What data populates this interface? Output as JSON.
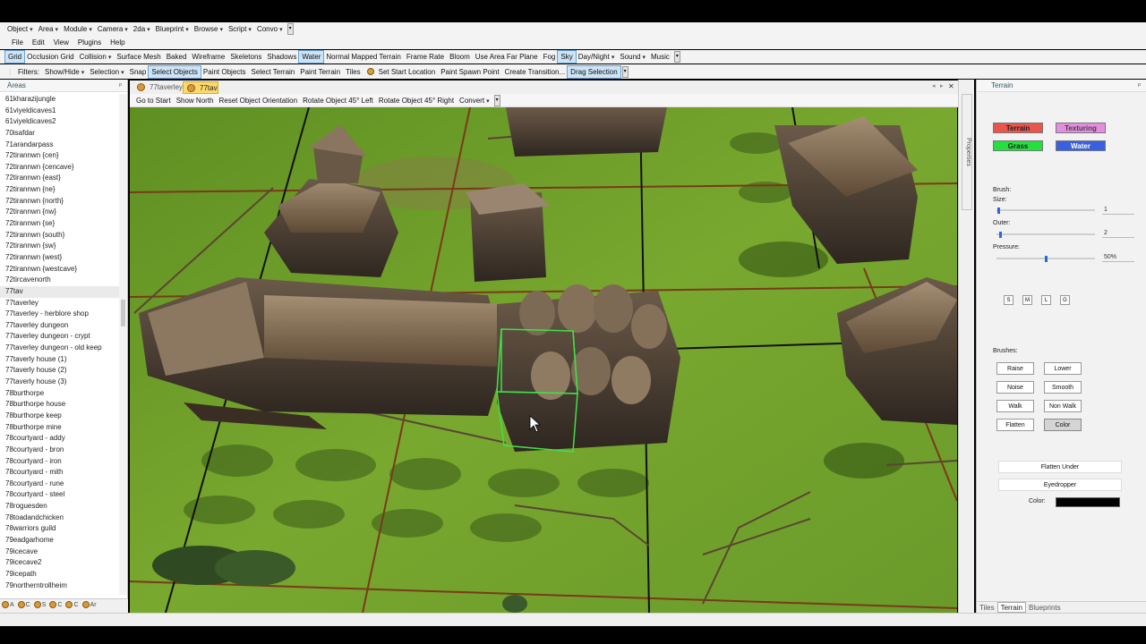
{
  "menu_top": [
    "Object",
    "Area",
    "Module",
    "Camera",
    "2da",
    "Blueprint",
    "Browse",
    "Script",
    "Convo"
  ],
  "menu_main": [
    "File",
    "Edit",
    "View",
    "Plugins",
    "Help"
  ],
  "render_toolbar": [
    {
      "label": "Grid",
      "active": true
    },
    {
      "label": "Occlusion Grid",
      "active": false
    },
    {
      "label": "Collision",
      "dropdown": true
    },
    {
      "label": "Surface Mesh"
    },
    {
      "label": "Baked"
    },
    {
      "label": "Wireframe"
    },
    {
      "label": "Skeletons"
    },
    {
      "label": "Shadows"
    },
    {
      "label": "Water",
      "active": true
    },
    {
      "label": "Normal Mapped Terrain"
    },
    {
      "label": "Frame Rate"
    },
    {
      "label": "Bloom"
    },
    {
      "label": "Use Area Far Plane"
    },
    {
      "label": "Fog"
    },
    {
      "label": "Sky",
      "active": true
    },
    {
      "label": "Day/Night",
      "dropdown": true
    },
    {
      "label": "Sound",
      "dropdown": true
    },
    {
      "label": "Music"
    }
  ],
  "object_toolbar": [
    {
      "label": "Filters:",
      "no_pad": true
    },
    {
      "label": "Show/Hide",
      "dropdown": true
    },
    {
      "label": "Selection",
      "dropdown": true
    },
    {
      "label": "Snap"
    },
    {
      "label": "Select Objects",
      "active": true
    },
    {
      "label": "Paint Objects"
    },
    {
      "label": "Select Terrain"
    },
    {
      "label": "Paint Terrain"
    },
    {
      "label": "Tiles"
    },
    {
      "label": "Set Start Location",
      "icon": true
    },
    {
      "label": "Paint Spawn Point"
    },
    {
      "label": "Create Transition..."
    },
    {
      "label": "Drag Selection",
      "active": true
    }
  ],
  "left_panel": {
    "title": "Areas",
    "pin": "ᵖ",
    "selected_index": 17,
    "items": [
      "61kharazijungle",
      "61viyeldicaves1",
      "61viyeldicaves2",
      "70isafdar",
      "71arandarpass",
      "72tirannwn {cen}",
      "72tirannwn {cencave}",
      "72tirannwn {east}",
      "72tirannwn {ne}",
      "72tirannwn {north}",
      "72tirannwn {nw}",
      "72tirannwn {se}",
      "72tirannwn {south}",
      "72tirannwn {sw}",
      "72tirannwn {west}",
      "72tirannwn {westcave}",
      "72tircavenorth",
      "77tav",
      "77taverley",
      "77taverley - herblore shop",
      "77taverley dungeon",
      "77taverley dungeon - crypt",
      "77taverley dungeon - old keep",
      "77taverly house (1)",
      "77taverly house (2)",
      "77taverly house (3)",
      "78burthorpe",
      "78burthorpe house",
      "78burthorpe keep",
      "78burthorpe mine",
      "78courtyard - addy",
      "78courtyard - bron",
      "78courtyard - iron",
      "78courtyard - mith",
      "78courtyard - rune",
      "78courtyard - steel",
      "78roguesden",
      "78toadandchicken",
      "78warriors guild",
      "79eadgarhome",
      "79icecave",
      "79icecave2",
      "79icepath",
      "79northerntrollheim"
    ],
    "bottom_tabs": [
      "A",
      "C",
      "S",
      "C",
      "C",
      "Ar"
    ]
  },
  "doc_tabs": [
    {
      "label": "77taverley",
      "active": false
    },
    {
      "label": "77tav",
      "active": true
    }
  ],
  "doc_controls": [
    "◂",
    "▸",
    "✕"
  ],
  "viewport_toolbar": [
    {
      "label": "Go to Start"
    },
    {
      "label": "Show North"
    },
    {
      "label": "Reset Object Orientation"
    },
    {
      "label": "Rotate Object 45° Left"
    },
    {
      "label": "Rotate Object 45° Right"
    },
    {
      "label": "Convert",
      "dropdown": true
    }
  ],
  "properties_strip_label": "Properties",
  "right_panel": {
    "title": "Terrain",
    "pin": "ᵖ",
    "modes": [
      {
        "label": "Terrain",
        "color": "#e8554d",
        "text": "#222"
      },
      {
        "label": "Texturing",
        "color": "#e48ee0",
        "text": "#444"
      },
      {
        "label": "Grass",
        "color": "#23e040",
        "text": "#222"
      },
      {
        "label": "Water",
        "color": "#3a5fe0",
        "text": "#fff"
      }
    ],
    "brush_label": "Brush:",
    "size_label": "Size:",
    "size_value": "1",
    "size_level": 0.02,
    "outer_label": "Outer:",
    "outer_value": "2",
    "outer_level": 0.04,
    "pressure_label": "Pressure:",
    "pressure_value": "50%",
    "pressure_level": 0.5,
    "size_buttons": [
      "S",
      "M",
      "L",
      "G"
    ],
    "brushes_label": "Brushes:",
    "brushes": [
      "Raise",
      "Lower",
      "Noise",
      "Smooth",
      "Walk",
      "Non Walk",
      "Flatten",
      "Color"
    ],
    "active_brush": "Color",
    "flatten_under": "Flatten Under",
    "eyedropper": "Eyedropper",
    "color_label": "Color:",
    "color_swatch": "#000000",
    "tabs": [
      "Tiles",
      "Terrain",
      "Blueprints"
    ],
    "active_tab": "Terrain"
  }
}
